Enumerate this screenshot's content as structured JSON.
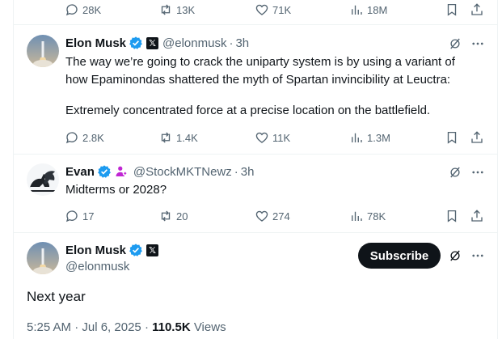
{
  "top_actions": {
    "replies": "28K",
    "reposts": "13K",
    "likes": "71K",
    "views": "18M"
  },
  "tweet1": {
    "name": "Elon Musk",
    "handle": "@elonmusk",
    "time": "3h",
    "line1": "The way we’re going to crack the uniparty system is by using a variant of",
    "line2": "how Epaminondas shattered the myth of Spartan invincibility at Leuctra:",
    "line3": "Extremely concentrated force at a precise location on the battlefield.",
    "replies": "2.8K",
    "reposts": "1.4K",
    "likes": "11K",
    "views": "1.3M"
  },
  "tweet2": {
    "name": "Evan",
    "handle": "@StockMKTNewz",
    "time": "3h",
    "text": "Midterms or 2028?",
    "replies": "17",
    "reposts": "20",
    "likes": "274",
    "views": "78K"
  },
  "main_tweet": {
    "name": "Elon Musk",
    "handle": "@elonmusk",
    "subscribe": "Subscribe",
    "text": "Next year",
    "timestamp": "5:25 AM · Jul 6, 2025",
    "views_count": "110.5K",
    "views_label": "Views"
  },
  "separator": "·",
  "colors": {
    "verified": "#1d9bf0",
    "text": "#0f1419",
    "muted": "#536471",
    "affiliate": "#c026d3"
  }
}
